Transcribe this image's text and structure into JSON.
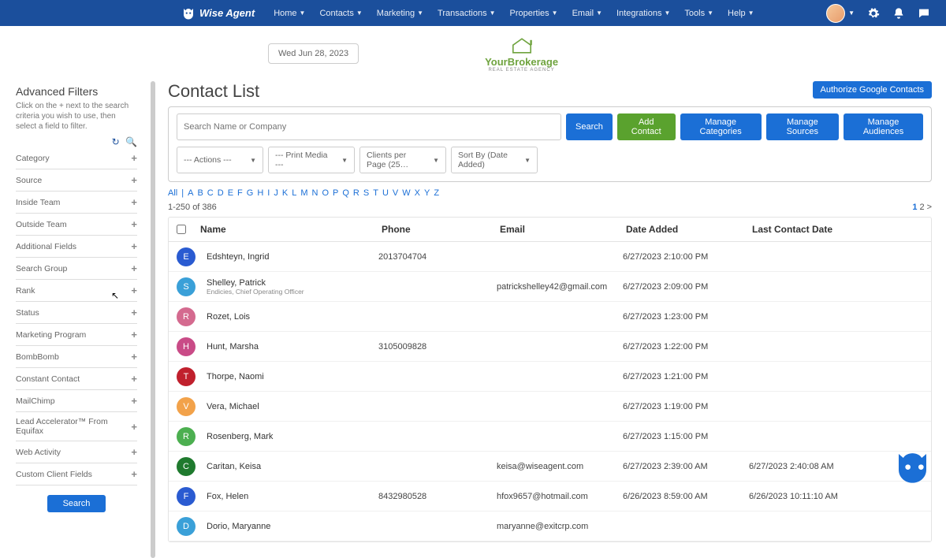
{
  "brand": {
    "name": "Wise Agent"
  },
  "nav": [
    "Home",
    "Contacts",
    "Marketing",
    "Transactions",
    "Properties",
    "Email",
    "Integrations",
    "Tools",
    "Help"
  ],
  "date_pill": "Wed Jun 28, 2023",
  "brokerage": {
    "title": "YourBrokerage",
    "subtitle": "REAL ESTATE AGENCY"
  },
  "sidebar": {
    "title": "Advanced Filters",
    "desc": "Click on the + next to the search criteria you wish to use, then select a field to filter.",
    "items": [
      "Category",
      "Source",
      "Inside Team",
      "Outside Team",
      "Additional Fields",
      "Search Group",
      "Rank",
      "Status",
      "Marketing Program",
      "BombBomb",
      "Constant Contact",
      "MailChimp",
      "Lead Accelerator™ From Equifax",
      "Web Activity",
      "Custom Client Fields"
    ],
    "search_btn": "Search"
  },
  "page": {
    "title": "Contact List",
    "auth_btn": "Authorize Google Contacts",
    "search_placeholder": "Search Name or Company",
    "search_btn": "Search",
    "add_btn": "Add Contact",
    "manage_cat": "Manage Categories",
    "manage_src": "Manage Sources",
    "manage_aud": "Manage Audiences",
    "dd_actions": "--- Actions ---",
    "dd_print": "--- Print Media ---",
    "dd_clients": "Clients per Page (25…",
    "dd_sort": "Sort By (Date Added)",
    "alpha": [
      "All",
      "|",
      "A",
      "B",
      "C",
      "D",
      "E",
      "F",
      "G",
      "H",
      "I",
      "J",
      "K",
      "L",
      "M",
      "N",
      "O",
      "P",
      "Q",
      "R",
      "S",
      "T",
      "U",
      "V",
      "W",
      "X",
      "Y",
      "Z"
    ],
    "count": "1-250 of 386",
    "pager": {
      "p1": "1",
      "p2": "2",
      "next": ">"
    },
    "cols": {
      "name": "Name",
      "phone": "Phone",
      "email": "Email",
      "date": "Date Added",
      "last": "Last Contact Date"
    }
  },
  "rows": [
    {
      "letter": "E",
      "color": "#2a5bd1",
      "name": "Edshteyn, Ingrid",
      "sub": "",
      "phone": "2013704704",
      "email": "",
      "date": "6/27/2023 2:10:00 PM",
      "last": ""
    },
    {
      "letter": "S",
      "color": "#3aa0d8",
      "name": "Shelley, Patrick",
      "sub": "Endicies, Chief Operating Officer",
      "phone": "",
      "email": "patrickshelley42@gmail.com",
      "date": "6/27/2023 2:09:00 PM",
      "last": ""
    },
    {
      "letter": "R",
      "color": "#d46a8f",
      "name": "Rozet, Lois",
      "sub": "",
      "phone": "",
      "email": "",
      "date": "6/27/2023 1:23:00 PM",
      "last": ""
    },
    {
      "letter": "H",
      "color": "#c94b87",
      "name": "Hunt, Marsha",
      "sub": "",
      "phone": "3105009828",
      "email": "",
      "date": "6/27/2023 1:22:00 PM",
      "last": ""
    },
    {
      "letter": "T",
      "color": "#c0202d",
      "name": "Thorpe, Naomi",
      "sub": "",
      "phone": "",
      "email": "",
      "date": "6/27/2023 1:21:00 PM",
      "last": ""
    },
    {
      "letter": "V",
      "color": "#f2a24a",
      "name": "Vera, Michael",
      "sub": "",
      "phone": "",
      "email": "",
      "date": "6/27/2023 1:19:00 PM",
      "last": ""
    },
    {
      "letter": "R",
      "color": "#4caf50",
      "name": "Rosenberg, Mark",
      "sub": "",
      "phone": "",
      "email": "",
      "date": "6/27/2023 1:15:00 PM",
      "last": ""
    },
    {
      "letter": "C",
      "color": "#1f7a2e",
      "name": "Caritan, Keisa",
      "sub": "",
      "phone": "",
      "email": "keisa@wiseagent.com",
      "date": "6/27/2023 2:39:00 AM",
      "last": "6/27/2023 2:40:08 AM"
    },
    {
      "letter": "F",
      "color": "#2a5bd1",
      "name": "Fox, Helen",
      "sub": "",
      "phone": "8432980528",
      "email": "hfox9657@hotmail.com",
      "date": "6/26/2023 8:59:00 AM",
      "last": "6/26/2023 10:11:10 AM"
    },
    {
      "letter": "D",
      "color": "#3aa0d8",
      "name": "Dorio, Maryanne",
      "sub": "",
      "phone": "",
      "email": "maryanne@exitcrp.com",
      "date": "",
      "last": ""
    }
  ]
}
